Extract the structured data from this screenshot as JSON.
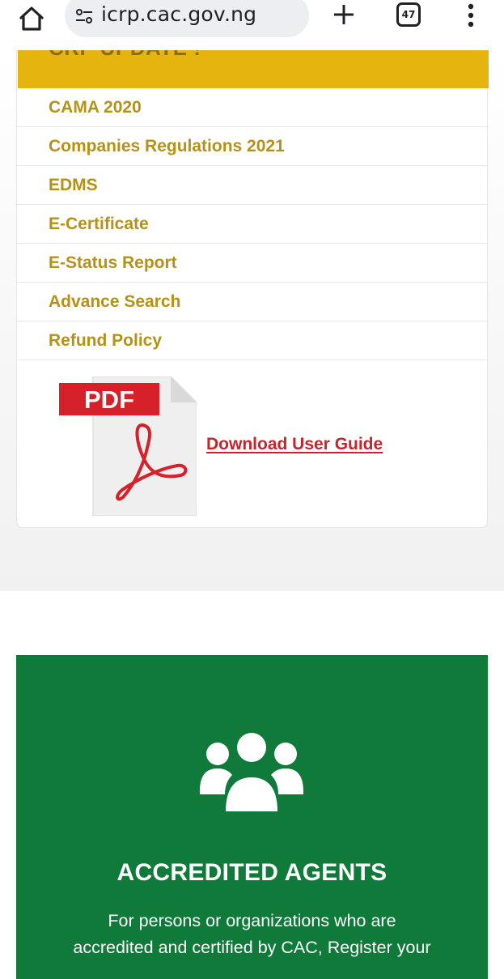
{
  "browser": {
    "url": "icrp.cac.gov.ng",
    "tab_count": "47",
    "icons": {
      "home": "home-icon",
      "site_settings": "tune-icon",
      "new_tab": "plus-icon",
      "tabs": "tab-switcher-icon",
      "menu": "more-vert-icon"
    }
  },
  "update_card": {
    "header": "CRP UPDATE !",
    "links": [
      "CAMA 2020",
      "Companies Regulations 2021",
      "EDMS",
      "E-Certificate",
      "E-Status Report",
      "Advance Search",
      "Refund Policy"
    ],
    "pdf_badge": "PDF",
    "download_label": "Download User Guide"
  },
  "agents": {
    "icon": "users-group-icon",
    "heading": "ACCREDITED AGENTS",
    "description_line1": "For persons or organizations who are",
    "description_line2": "accredited and certified by CAC, Register your"
  },
  "colors": {
    "header_yellow": "#e6b40f",
    "link_gold": "#b59215",
    "download_red": "#c4262e",
    "pdf_red": "#d6202a",
    "agents_green": "#0f7a3a"
  }
}
